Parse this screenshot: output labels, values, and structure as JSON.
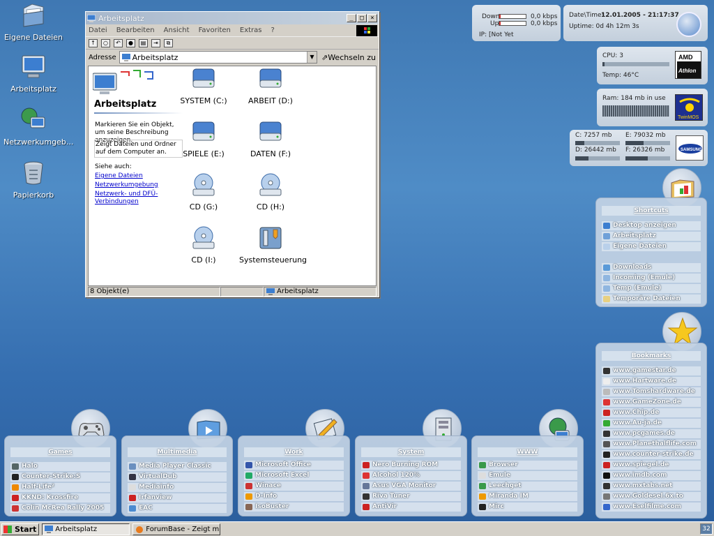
{
  "desktop_icons": [
    {
      "label": "Eigene Dateien",
      "icon": "folder-documents-icon"
    },
    {
      "label": "Arbeitsplatz",
      "icon": "my-computer-icon"
    },
    {
      "label": "Netzwerkumgeb...",
      "icon": "network-icon"
    },
    {
      "label": "Papierkorb",
      "icon": "recycle-bin-icon"
    }
  ],
  "explorer": {
    "title": "Arbeitsplatz",
    "menu": [
      "Datei",
      "Bearbeiten",
      "Ansicht",
      "Favoriten",
      "Extras",
      "?"
    ],
    "address_label": "Adresse",
    "address_value": "Arbeitsplatz",
    "go_label": "Wechseln zu",
    "pane_title": "Arbeitsplatz",
    "pane_text": "Markieren Sie ein Objekt, um seine Beschreibung anzuzeigen.",
    "pane_text2": "Zeigt Dateien und Ordner auf dem Computer an.",
    "see_also": "Siehe auch:",
    "links": [
      "Eigene Dateien",
      "Netzwerkumgebung",
      "Netzwerk- und DFÜ-Verbindungen"
    ],
    "drives": [
      {
        "label": "SYSTEM (C:)",
        "type": "hdd"
      },
      {
        "label": "ARBEIT (D:)",
        "type": "hdd"
      },
      {
        "label": "SPIELE (E:)",
        "type": "hdd"
      },
      {
        "label": "DATEN (F:)",
        "type": "hdd"
      },
      {
        "label": "CD (G:)",
        "type": "cd"
      },
      {
        "label": "CD (H:)",
        "type": "cd"
      },
      {
        "label": "CD (I:)",
        "type": "cd"
      },
      {
        "label": "Systemsteuerung",
        "type": "control"
      }
    ],
    "status_count": "8 Objekt(e)",
    "status_location": "Arbeitsplatz"
  },
  "net_widget": {
    "down_label": "Down",
    "up_label": "Up",
    "down_value": "0,0 kbps",
    "up_value": "0,0 kbps",
    "ip": "IP: [Not Yet"
  },
  "time_widget": {
    "date_label": "Date\\Time:",
    "date_value": "12.01.2005 - 21:17:37",
    "uptime": "Uptime: 0d 4h 12m 3s"
  },
  "cpu_widget": {
    "cpu": "CPU: 3",
    "temp": "Temp: 46°C",
    "load": 0.03
  },
  "ram_widget": {
    "ram": "Ram: 184 mb in use"
  },
  "disk_widget": {
    "disks": [
      {
        "text": "C: 7257 mb",
        "fill": 0.2
      },
      {
        "text": "E: 79032 mb",
        "fill": 0.4
      },
      {
        "text": "D: 26442 mb",
        "fill": 0.3
      },
      {
        "text": "F: 26326 mb",
        "fill": 0.5
      }
    ]
  },
  "shortcuts": {
    "title": "Shortcuts",
    "group1": [
      "Desktop anzeigen",
      "Arbeitsplatz",
      "Eigene Dateien"
    ],
    "group2": [
      "Downloads",
      "Incoming (Emule)",
      "Temp (Emule)",
      "Temporäre Dateien"
    ]
  },
  "bookmarks": {
    "title": "Bookmarks",
    "items": [
      "www.gamestar.de",
      "www.Hartware.de",
      "www.Tomshardware.de",
      "www.GameZone.de",
      "www.Chip.de",
      "www.Au-ja.de",
      "www.pcgames.de",
      "www.Planethalflife.com",
      "www.counter-strike.de",
      "www.spiegel.de",
      "www.imdb.com",
      "www.mxtabs.net",
      "www.Goldesel.6x.to",
      "www.Eselfilme.com"
    ]
  },
  "dock_panels": [
    {
      "title": "Games",
      "items": [
        "Halo",
        "Counter-Strike:S",
        "Half-Life²",
        "KKND: Krossfire",
        "Colin McRea Rally 2005"
      ]
    },
    {
      "title": "Multimedia",
      "items": [
        "Media Player Classic",
        "VirtualDub",
        "Mediainfo",
        "Irfanview",
        "EAC"
      ]
    },
    {
      "title": "Work",
      "items": [
        "Microsoft Office",
        "Microsoft Excel",
        "Winace",
        "D-Info",
        "IsoBuster"
      ]
    },
    {
      "title": "System",
      "items": [
        "Nero Burning ROM",
        "Alcohol 120%",
        "Asus VGA Monitor",
        "Riva Tuner",
        "AntiVir"
      ]
    },
    {
      "title": "WWW",
      "items": [
        "Browser",
        "Emule",
        "Leechget",
        "Miranda IM",
        "Mirc"
      ]
    }
  ],
  "taskbar": {
    "start": "Start",
    "tasks": [
      "Arbeitsplatz",
      "ForumBase - Zeigt mir eure..."
    ],
    "tray": "32"
  },
  "colors": {
    "accent": "#3f78b3",
    "link": "#0000cc",
    "panel": "#c3d2e4"
  }
}
